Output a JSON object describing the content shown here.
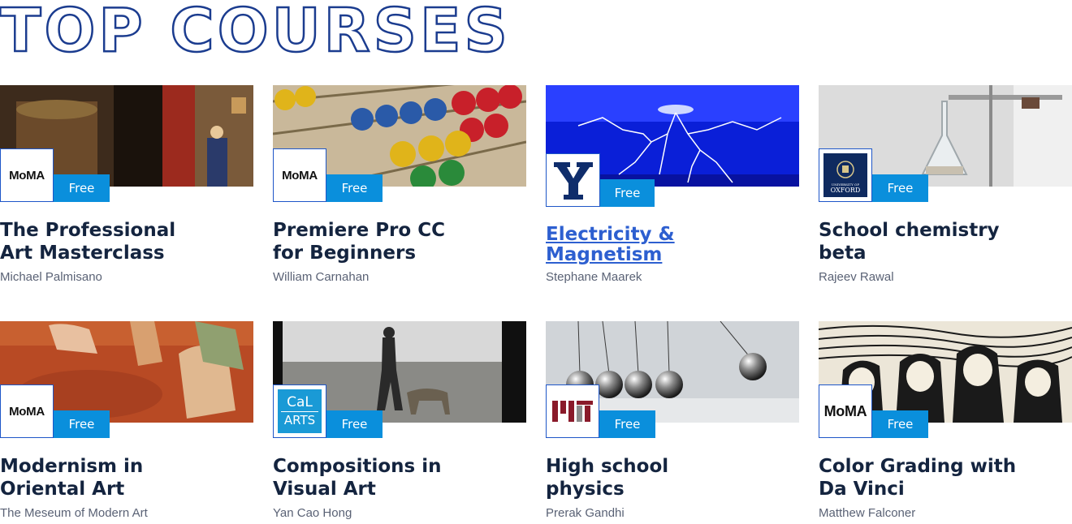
{
  "page": {
    "title": "TOP COURSES"
  },
  "brand": {
    "accent": "#0a8fdc",
    "title_outline": "#1b3c8f",
    "link_hover": "#2d5fd0"
  },
  "courses": [
    {
      "title_line1": "The Professional",
      "title_line2": "Art Masterclass",
      "author": "Michael Palmisano",
      "badge": "Free",
      "logo_text": "MoMA",
      "logo_icon": "moma-logo"
    },
    {
      "title_line1": "Premiere Pro CC",
      "title_line2": "for Beginners",
      "author": "William Carnahan",
      "badge": "Free",
      "logo_text": "MoMA",
      "logo_icon": "moma-logo"
    },
    {
      "title_line1": "Electricity &",
      "title_line2": "Magnetism",
      "author": "Stephane Maarek",
      "badge": "Free",
      "logo_text": "Y",
      "logo_icon": "yale-logo",
      "hovered": true
    },
    {
      "title_line1": "School chemistry",
      "title_line2": "beta",
      "author": "Rajeev Rawal",
      "badge": "Free",
      "logo_text": "UNIVERSITY OF OXFORD",
      "logo_icon": "oxford-logo"
    },
    {
      "title_line1": "Modernism in",
      "title_line2": "Oriental Art",
      "author": "The Meseum of Modern Art",
      "badge": "Free",
      "logo_text": "MoMA",
      "logo_icon": "moma-logo"
    },
    {
      "title_line1": "Compositions in",
      "title_line2": "Visual Art",
      "author": "Yan Cao Hong",
      "badge": "Free",
      "logo_text_1": "CaL",
      "logo_text_2": "ARTS",
      "logo_icon": "calarts-logo"
    },
    {
      "title_line1": "High school",
      "title_line2": "physics",
      "author": "Prerak Gandhi",
      "badge": "Free",
      "logo_icon": "mit-logo"
    },
    {
      "title_line1": "Color Grading with",
      "title_line2": "Da Vinci",
      "author": "Matthew Falconer",
      "badge": "Free",
      "logo_text": "MoMA",
      "logo_icon": "moma-logo"
    }
  ]
}
